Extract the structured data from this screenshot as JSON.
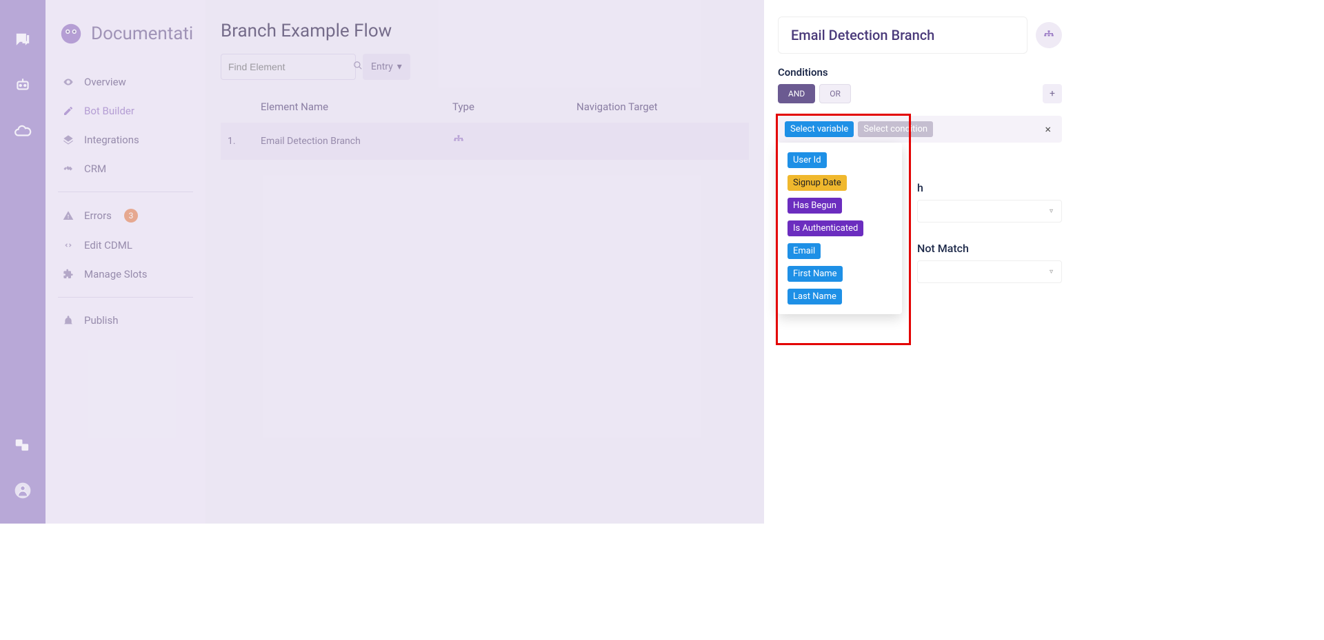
{
  "iconbar": {
    "items": [
      "chat-icon",
      "bot-icon",
      "cloud-icon"
    ],
    "footer_items": [
      "translate-icon",
      "user-icon"
    ]
  },
  "sidebar": {
    "brand": "Documentation",
    "items": [
      {
        "icon": "eye",
        "label": "Overview"
      },
      {
        "icon": "pencil",
        "label": "Bot Builder",
        "active": true
      },
      {
        "icon": "layers",
        "label": "Integrations"
      },
      {
        "icon": "handshake",
        "label": "CRM"
      }
    ],
    "items2": [
      {
        "icon": "warning",
        "label": "Errors",
        "badge": "3"
      },
      {
        "icon": "code",
        "label": "Edit CDML"
      },
      {
        "icon": "puzzle",
        "label": "Manage Slots"
      }
    ],
    "items3": [
      {
        "icon": "broadcast",
        "label": "Publish"
      }
    ]
  },
  "main": {
    "title": "Branch Example Flow",
    "search_placeholder": "Find Element",
    "dropdown_label": "Entry",
    "columns": {
      "name": "Element Name",
      "type": "Type",
      "target": "Navigation Target"
    },
    "rows": [
      {
        "index": "1.",
        "name": "Email Detection Branch",
        "type": "branch",
        "target": ""
      }
    ]
  },
  "panel": {
    "title": "Email Detection Branch",
    "conditions_label": "Conditions",
    "and_label": "AND",
    "or_label": "OR",
    "select_variable": "Select variable",
    "select_condition": "Select condition",
    "variables": [
      {
        "label": "User Id",
        "cls": "var-blue"
      },
      {
        "label": "Signup Date",
        "cls": "var-yellow"
      },
      {
        "label": "Has Begun",
        "cls": "var-purple"
      },
      {
        "label": "Is Authenticated",
        "cls": "var-purple"
      },
      {
        "label": "Email",
        "cls": "var-blue"
      },
      {
        "label": "First Name",
        "cls": "var-blue"
      },
      {
        "label": "Last Name",
        "cls": "var-blue"
      }
    ],
    "match_title_suffix": "h",
    "nomatch_title_suffix": "Not Match"
  }
}
